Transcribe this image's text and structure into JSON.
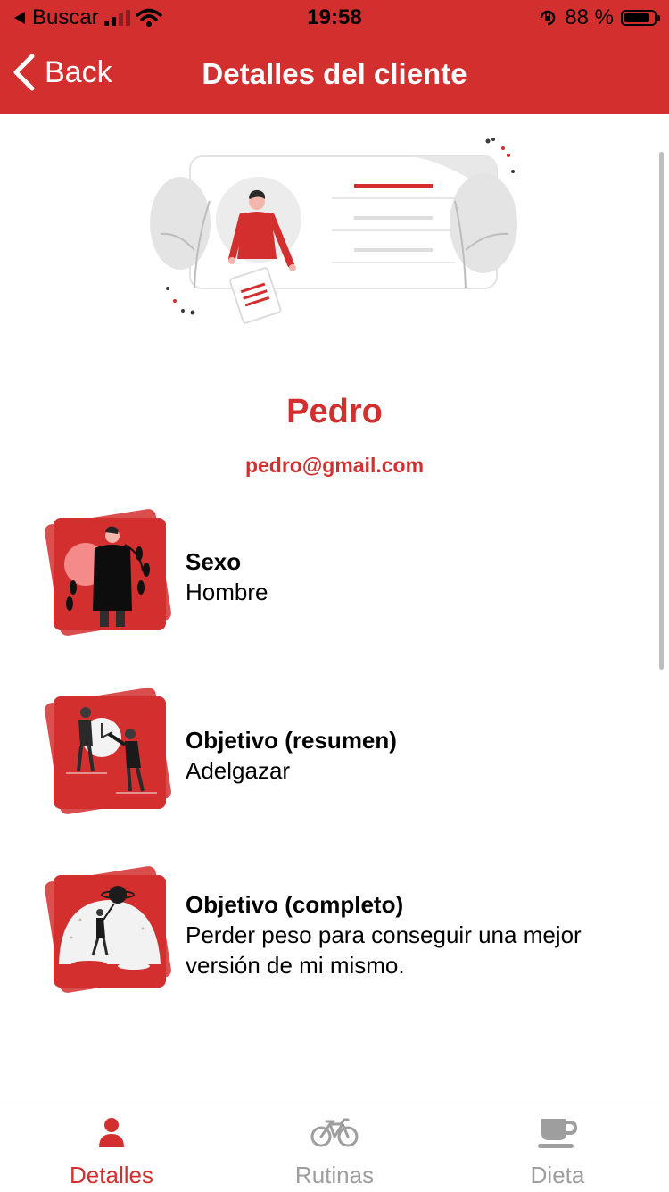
{
  "status_bar": {
    "back_app": "Buscar",
    "time": "19:58",
    "battery_percent": "88 %",
    "battery_level": 0.88
  },
  "nav": {
    "back_label": "Back",
    "title": "Detalles del cliente"
  },
  "client": {
    "name": "Pedro",
    "email": "pedro@gmail.com"
  },
  "details": [
    {
      "label": "Sexo",
      "value": "Hombre",
      "icon": "person-illustration-icon"
    },
    {
      "label": "Objetivo (resumen)",
      "value": "Adelgazar",
      "icon": "clock-illustration-icon"
    },
    {
      "label": "Objetivo (completo)",
      "value": "Perder peso para conseguir una mejor versión de mi mismo.",
      "icon": "planet-illustration-icon"
    }
  ],
  "tabs": [
    {
      "label": "Detalles",
      "icon": "person-icon",
      "active": true
    },
    {
      "label": "Rutinas",
      "icon": "bicycle-icon",
      "active": false
    },
    {
      "label": "Dieta",
      "icon": "coffee-cup-icon",
      "active": false
    }
  ],
  "colors": {
    "accent": "#d32f2f",
    "tab_inactive": "#9e9e9e",
    "background": "#ffffff"
  }
}
